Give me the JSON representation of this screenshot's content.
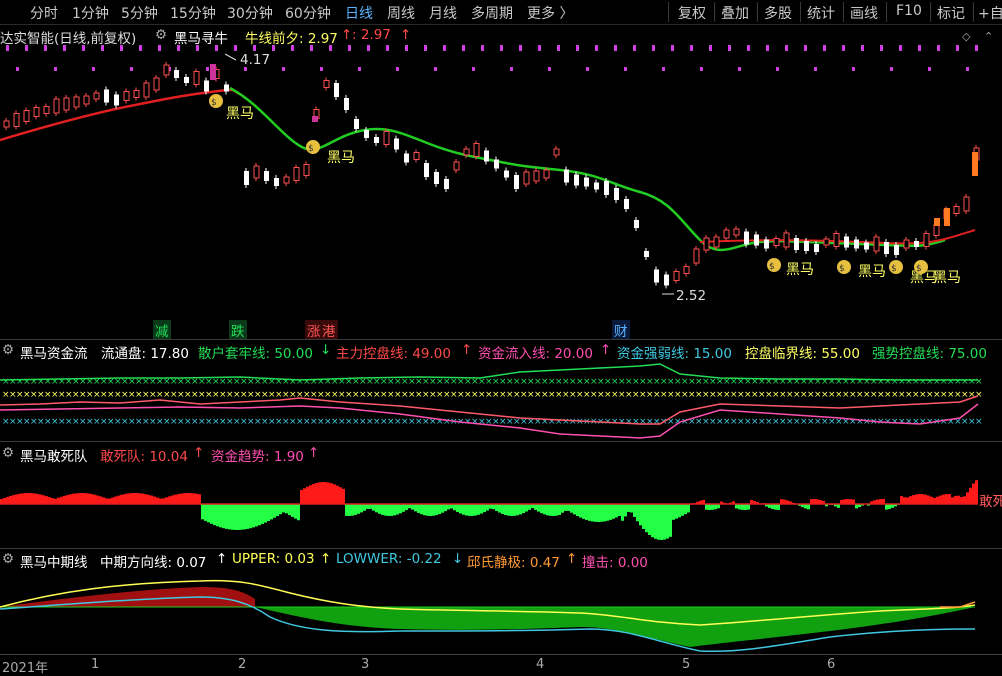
{
  "toolbar": {
    "periods": [
      "分时",
      "1分钟",
      "5分钟",
      "15分钟",
      "30分钟",
      "60分钟",
      "日线",
      "周线",
      "月线",
      "多周期",
      "更多 〉"
    ],
    "active_period": "日线",
    "right_buttons": [
      "复权",
      "叠加",
      "多股",
      "统计",
      "画线",
      "F10",
      "标记",
      "+自"
    ]
  },
  "main_header": {
    "stock": "达实智能(日线,前复权)",
    "indicator": "黑马寻牛",
    "niu_label": "牛线前夕: 2.97",
    "niu_arrow": "↑",
    "value2": ": 2.97",
    "value2_arrow": "↑"
  },
  "price_labels": {
    "high": "4.17",
    "low": "2.52"
  },
  "heima_label": "黑马",
  "event_tags": [
    "减",
    "跌",
    "涨",
    "港",
    "财"
  ],
  "panel2": {
    "title": "黑马资金流",
    "items": [
      {
        "text": "流通盘: 17.80",
        "color": "#ffffff"
      },
      {
        "text": "散户套牢线: 50.00",
        "arrow": "↓",
        "color": "#22dd55"
      },
      {
        "text": "主力控盘线: 49.00",
        "arrow": "↑",
        "color": "#ff4a4a"
      },
      {
        "text": "资金流入线: 20.00",
        "arrow": "↑",
        "color": "#ff4fb0"
      },
      {
        "text": "资金强弱线: 15.00",
        "color": "#40c8e0"
      },
      {
        "text": "控盘临界线: 55.00",
        "color": "#ffff66"
      },
      {
        "text": "强势控盘线: 75.00",
        "color": "#22dd55"
      }
    ]
  },
  "panel3": {
    "title": "黑马敢死队",
    "items": [
      {
        "text": "敢死队: 10.04",
        "arrow": "↑",
        "color": "#ff4a4a"
      },
      {
        "text": "资金趋势: 1.90",
        "arrow": "↑",
        "color": "#ff4fb0"
      }
    ],
    "edge_label": "敢死"
  },
  "panel4": {
    "title": "黑马中期线",
    "items": [
      {
        "text": "中期方向线: 0.07",
        "arrow": "↑",
        "color": "#ffffff"
      },
      {
        "text": "UPPER: 0.03",
        "arrow": "↑",
        "color": "#ffff55"
      },
      {
        "text": "LOWWER: -0.22",
        "arrow": "↓",
        "color": "#40c8e0"
      },
      {
        "text": "邱氏静极: 0.47",
        "arrow": "↑",
        "color": "#ff9933"
      },
      {
        "text": "撞击: 0.00",
        "color": "#ff4fb0"
      }
    ]
  },
  "xaxis": [
    "2021年",
    "1",
    "2",
    "3",
    "4",
    "5",
    "6"
  ]
}
